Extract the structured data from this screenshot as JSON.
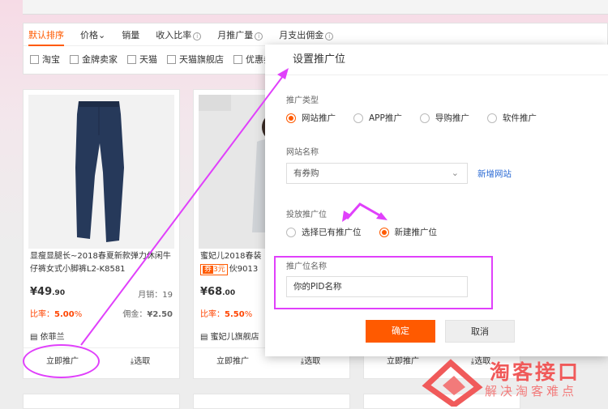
{
  "sort_bar": {
    "items": [
      "默认排序",
      "价格",
      "销量",
      "收入比率",
      "月推广量",
      "月支出佣金"
    ]
  },
  "filters": [
    "淘宝",
    "金牌卖家",
    "天猫",
    "天猫旗舰店",
    "优惠券"
  ],
  "products": [
    {
      "title": "显瘦显腿长~2018春夏新款弹力休闲牛仔裤女式小脚裤L2-K8581",
      "price_main": "¥49",
      "price_dec": ".90",
      "sales_label": "月销：19",
      "ratio_label": "比率：",
      "ratio_value": "5.00",
      "ratio_unit": "%",
      "commission_label": "佣金：",
      "commission_value": "¥2.50",
      "shop": "依菲兰",
      "promote": "立即推广",
      "select": "选取"
    },
    {
      "title_a": "蜜妃儿2018春装",
      "coupon_a": "券",
      "coupon_b": "3元",
      "title_b": "伙9013",
      "price_main": "¥68",
      "price_dec": ".00",
      "ratio_label": "比率：",
      "ratio_value": "5.50",
      "ratio_unit": "%",
      "shop": "蜜妃儿旗舰店",
      "promote": "立即推广",
      "select": "选取"
    },
    {
      "promote": "立即推广",
      "select": "选取"
    }
  ],
  "modal": {
    "title": "设置推广位",
    "type_label": "推广类型",
    "types": [
      "网站推广",
      "APP推广",
      "导购推广",
      "软件推广"
    ],
    "site_label": "网站名称",
    "site_value": "有券购",
    "add_site": "新增网站",
    "position_label": "投放推广位",
    "position_options": [
      "选择已有推广位",
      "新建推广位"
    ],
    "name_label": "推广位名称",
    "name_value": "你的PID名称",
    "ok": "确定",
    "cancel": "取消"
  },
  "watermark": {
    "title": "淘客接口",
    "subtitle": "解决淘客难点"
  },
  "colors": {
    "accent": "#ff5a00",
    "annotation": "#e040fb",
    "link": "#2a6ad4"
  }
}
